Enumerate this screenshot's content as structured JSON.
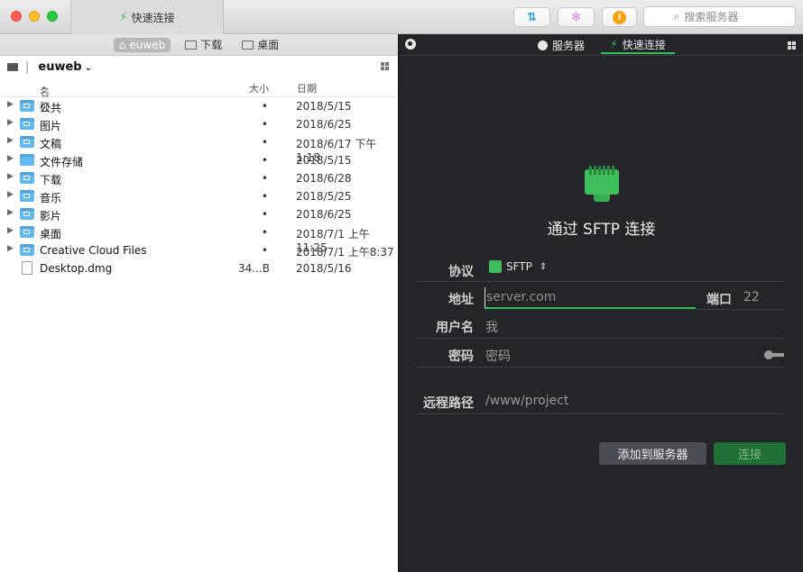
{
  "titlebar": {
    "tab_title": "快速连接",
    "search_placeholder": "搜索服务器"
  },
  "left": {
    "location_tabs": [
      {
        "label": "euweb",
        "active": true
      },
      {
        "label": "下载",
        "active": false
      },
      {
        "label": "桌面",
        "active": false
      }
    ],
    "path_name": "euweb",
    "columns": {
      "name": "名称",
      "size": "大小",
      "date": "日期"
    },
    "files": [
      {
        "name": "公共",
        "size": "•",
        "date": "2018/5/15",
        "type": "folder"
      },
      {
        "name": "图片",
        "size": "•",
        "date": "2018/6/25",
        "type": "folder"
      },
      {
        "name": "文稿",
        "size": "•",
        "date": "2018/6/17 下午1:18",
        "type": "folder"
      },
      {
        "name": "文件存储",
        "size": "•",
        "date": "2018/5/15",
        "type": "folder"
      },
      {
        "name": "下载",
        "size": "•",
        "date": "2018/6/28",
        "type": "folder"
      },
      {
        "name": "音乐",
        "size": "•",
        "date": "2018/5/25",
        "type": "folder"
      },
      {
        "name": "影片",
        "size": "•",
        "date": "2018/6/25",
        "type": "folder"
      },
      {
        "name": "桌面",
        "size": "•",
        "date": "2018/7/1 上午11:25",
        "type": "folder"
      },
      {
        "name": "Creative Cloud Files",
        "size": "•",
        "date": "2018/7/1 上午8:37",
        "type": "folder"
      },
      {
        "name": "Desktop.dmg",
        "size": "34...B",
        "date": "2018/5/16",
        "type": "file"
      }
    ]
  },
  "right": {
    "tabs": {
      "servers": "服务器",
      "quick": "快速连接"
    },
    "heading": "通过 SFTP 连接",
    "protocol_label": "协议",
    "protocol_value": "SFTP",
    "address_label": "地址",
    "address_placeholder": "server.com",
    "port_label": "端口",
    "port_value": "22",
    "username_label": "用户名",
    "username_value": "我",
    "password_label": "密码",
    "password_placeholder": "密码",
    "remote_path_label": "远程路径",
    "remote_path_placeholder": "/www/project",
    "add_button": "添加到服务器",
    "connect_button": "连接"
  },
  "colors": {
    "accent": "#2ec35a",
    "dark_panel": "#232529"
  }
}
